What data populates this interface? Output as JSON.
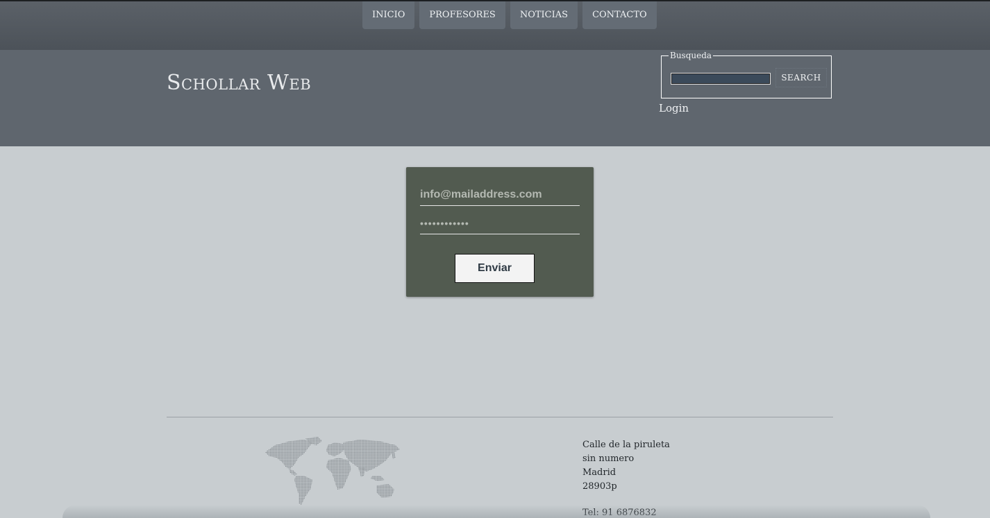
{
  "nav": {
    "items": [
      {
        "label": "INICIO"
      },
      {
        "label": "PROFESORES"
      },
      {
        "label": "NOTICIAS"
      },
      {
        "label": "CONTACTO"
      }
    ]
  },
  "header": {
    "site_title": "Schollar Web",
    "search": {
      "legend": "Busqueda",
      "input_value": "",
      "button_label": "SEARCH"
    },
    "login_label": "Login"
  },
  "login_form": {
    "email_placeholder": "info@mailaddress.com",
    "password_value": "••••••••••••",
    "submit_label": "Enviar"
  },
  "footer": {
    "address_lines": [
      "Calle de la piruleta",
      "sin numero",
      "Madrid",
      "28903p"
    ],
    "tel": "Tel: 91 6876832"
  },
  "colors": {
    "nav_bg": "#4f555c",
    "header_bg": "#5f666e",
    "page_bg": "#c8cdd0",
    "form_bg": "#525b50"
  },
  "icons": {
    "footer_map": "world-map-icon"
  }
}
